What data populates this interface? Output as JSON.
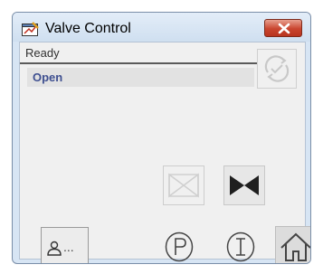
{
  "window": {
    "title": "Valve Control"
  },
  "status": {
    "text": "Ready"
  },
  "valve": {
    "state": "Open"
  },
  "user_button": {
    "label": "..."
  },
  "icons": {
    "app": "valve-faceplate-app-icon",
    "close": "close-x-icon",
    "refresh": "refresh-arrows-icon",
    "close_valve": "valve-closed-icon",
    "open_valve": "valve-open-icon",
    "user": "user-icon",
    "parameter": "p-circle-icon",
    "info": "i-circle-icon",
    "home": "home-icon"
  },
  "colors": {
    "close_button": "#c9452f",
    "state_text": "#3e4f90",
    "valve_active": "#1f1f1f"
  }
}
